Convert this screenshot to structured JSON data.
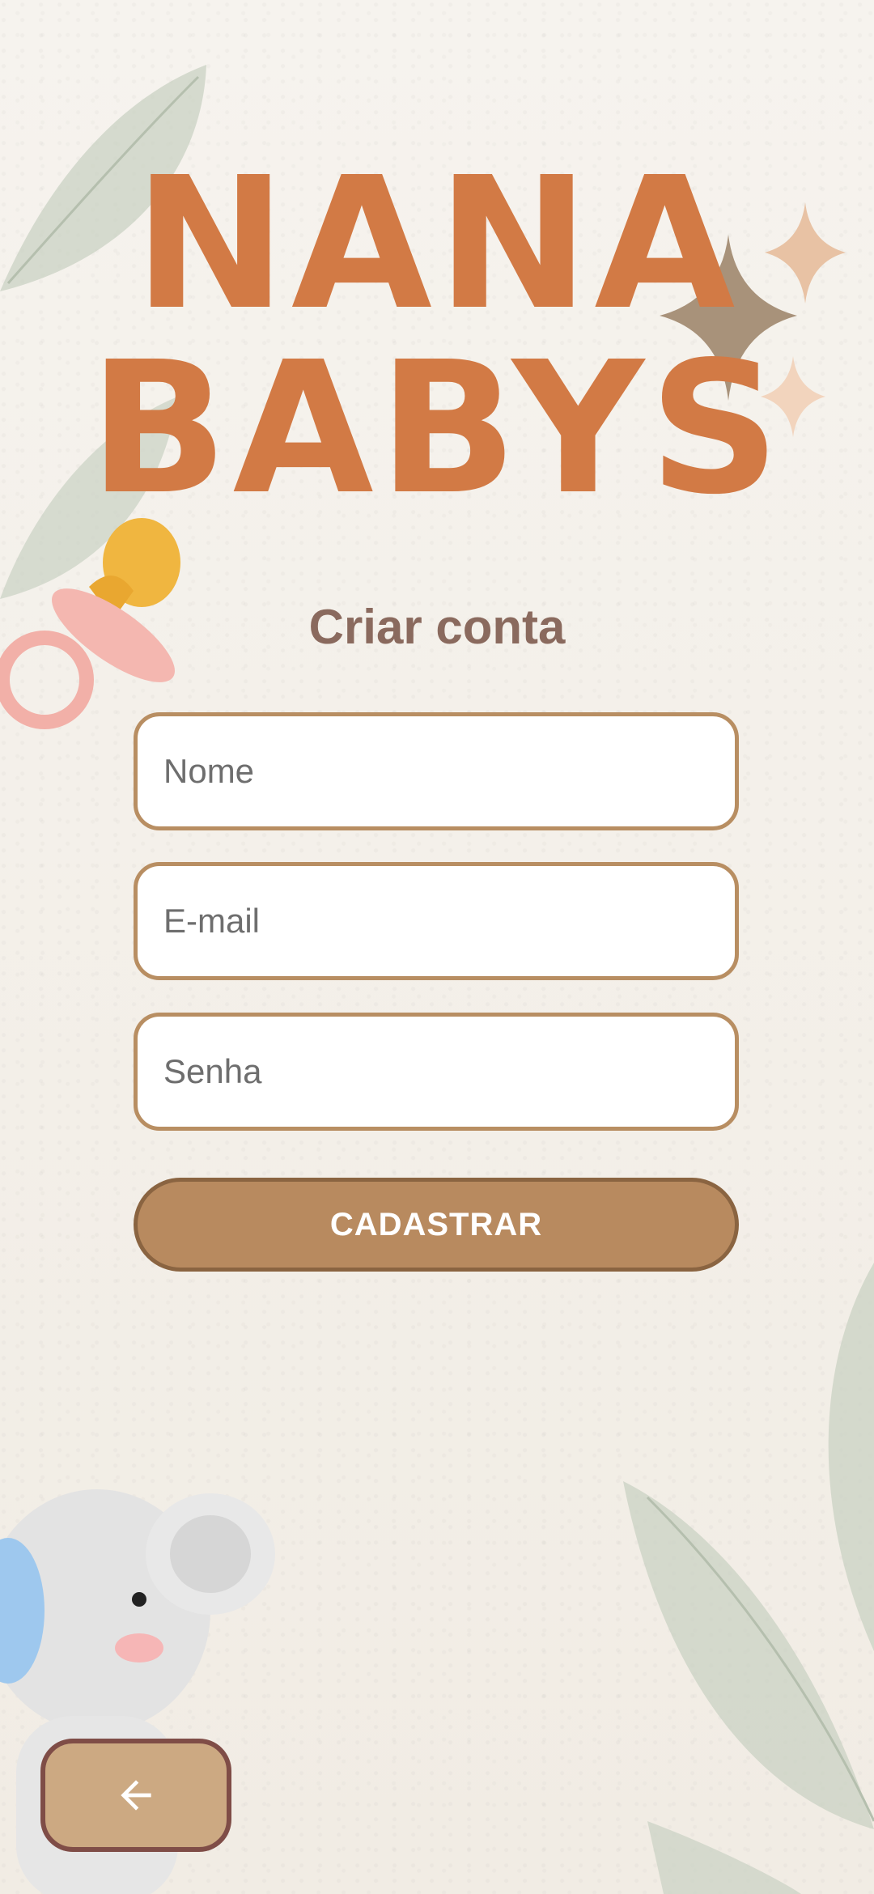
{
  "app": {
    "logo_line1": "NANA",
    "logo_line2": "BABYS"
  },
  "form": {
    "title": "Criar conta",
    "name_placeholder": "Nome",
    "email_placeholder": "E-mail",
    "password_placeholder": "Senha",
    "submit_label": "CADASTRAR"
  },
  "nav": {
    "back_icon": "arrow-left-icon"
  },
  "colors": {
    "logo": "#d27a45",
    "title": "#8a6a5e",
    "field_border": "#b88e62",
    "button": "#b88a5f",
    "back_button": "#cca982",
    "back_border": "#7f4d47"
  }
}
